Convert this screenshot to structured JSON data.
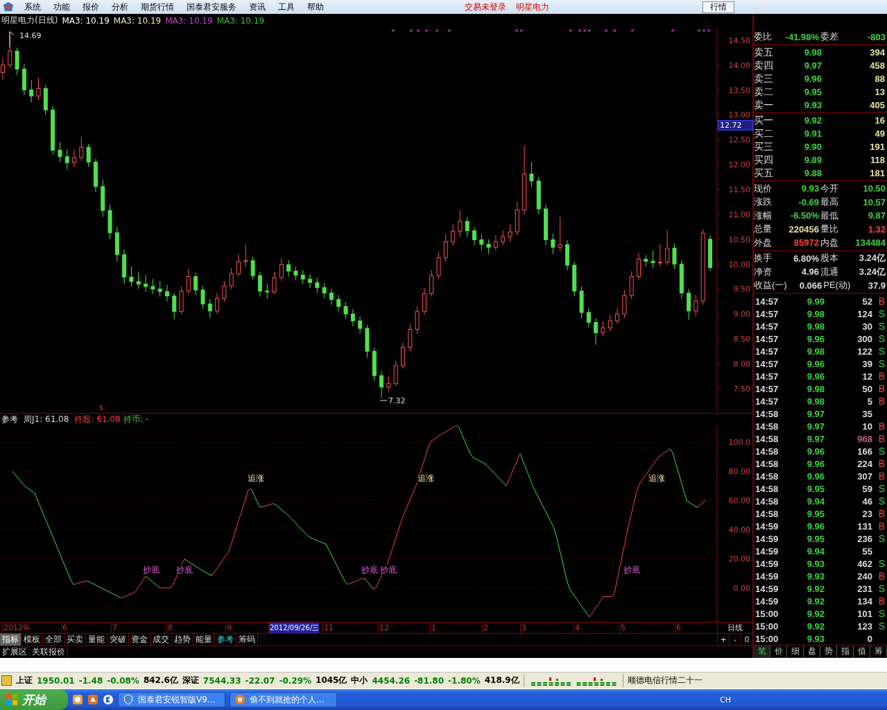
{
  "menu": {
    "items": [
      "系统",
      "功能",
      "报价",
      "分析",
      "期货行情",
      "国泰君安服务",
      "资讯",
      "工具",
      "帮助"
    ],
    "status_texts": [
      "交易未登录",
      "明星电力"
    ],
    "button": "行情"
  },
  "price_chart": {
    "title": "明星电力(日线)",
    "ma": [
      {
        "label": "MA3: 10.19",
        "color": "#ffffff"
      },
      {
        "label": "MA3: 10.19",
        "color": "#f0e8b0"
      },
      {
        "label": "MA3: 10.19",
        "color": "#d040d0"
      },
      {
        "label": "MA3: 10.19",
        "color": "#40c040"
      }
    ],
    "high_label": "14.69",
    "low_label": "7.32",
    "marker": "S",
    "price_tag": "12.72",
    "chart_data": {
      "type": "candlestick",
      "ylim": [
        7.01,
        14.75
      ],
      "yticks": [
        {
          "value": 14.5,
          "label": "14.50"
        },
        {
          "value": 14,
          "label": "14.00"
        },
        {
          "value": 13.5,
          "label": "13.50"
        },
        {
          "value": 13,
          "label": "13.00"
        },
        {
          "value": 12.5,
          "label": "12.50"
        },
        {
          "value": 12,
          "label": "12.00"
        },
        {
          "value": 11.5,
          "label": "11.50"
        },
        {
          "value": 11,
          "label": "11.00"
        },
        {
          "value": 10.5,
          "label": "10.50"
        },
        {
          "value": 10,
          "label": "10.00"
        },
        {
          "value": 9.5,
          "label": "9.50"
        },
        {
          "value": 9,
          "label": "9.00"
        },
        {
          "value": 8.5,
          "label": "8.50"
        },
        {
          "value": 8,
          "label": "8.00"
        },
        {
          "value": 7.5,
          "label": "7.50"
        }
      ],
      "ohlc": [
        [
          13.85,
          14.15,
          13.7,
          14.0
        ],
        [
          14.0,
          14.69,
          13.95,
          14.28
        ],
        [
          14.28,
          14.35,
          13.8,
          13.92
        ],
        [
          13.92,
          14.02,
          13.4,
          13.5
        ],
        [
          13.5,
          13.7,
          13.25,
          13.38
        ],
        [
          13.38,
          13.75,
          13.3,
          13.53
        ],
        [
          13.53,
          13.6,
          13.0,
          13.1
        ],
        [
          13.1,
          13.18,
          12.2,
          12.29
        ],
        [
          12.29,
          12.45,
          12.05,
          12.16
        ],
        [
          12.16,
          12.3,
          11.9,
          12.04
        ],
        [
          12.04,
          12.3,
          11.95,
          12.14
        ],
        [
          12.14,
          12.55,
          12.08,
          12.35
        ],
        [
          12.35,
          12.42,
          11.95,
          12.05
        ],
        [
          12.05,
          12.12,
          11.45,
          11.56
        ],
        [
          11.56,
          11.7,
          10.95,
          11.08
        ],
        [
          11.08,
          11.2,
          10.5,
          10.63
        ],
        [
          10.63,
          10.75,
          10.05,
          10.19
        ],
        [
          10.19,
          10.3,
          9.6,
          9.74
        ],
        [
          9.74,
          9.95,
          9.55,
          9.65
        ],
        [
          9.65,
          9.85,
          9.5,
          9.6
        ],
        [
          9.6,
          9.78,
          9.44,
          9.55
        ],
        [
          9.55,
          9.7,
          9.4,
          9.5
        ],
        [
          9.5,
          9.66,
          9.35,
          9.45
        ],
        [
          9.45,
          9.58,
          9.25,
          9.36
        ],
        [
          9.36,
          9.42,
          8.9,
          9.05
        ],
        [
          9.05,
          9.55,
          9.0,
          9.46
        ],
        [
          9.46,
          9.9,
          9.4,
          9.75
        ],
        [
          9.75,
          9.82,
          9.38,
          9.48
        ],
        [
          9.48,
          9.56,
          9.1,
          9.2
        ],
        [
          9.2,
          9.3,
          8.92,
          9.06
        ],
        [
          9.06,
          9.42,
          9.0,
          9.31
        ],
        [
          9.31,
          9.66,
          9.25,
          9.56
        ],
        [
          9.56,
          9.92,
          9.5,
          9.81
        ],
        [
          9.81,
          10.2,
          9.75,
          10.05
        ],
        [
          10.05,
          10.4,
          9.95,
          10.07
        ],
        [
          10.07,
          10.15,
          9.68,
          9.77
        ],
        [
          9.77,
          9.85,
          9.35,
          9.46
        ],
        [
          9.46,
          9.6,
          9.3,
          9.44
        ],
        [
          9.44,
          9.85,
          9.4,
          9.73
        ],
        [
          9.73,
          10.12,
          9.66,
          9.99
        ],
        [
          9.99,
          10.08,
          9.75,
          9.86
        ],
        [
          9.86,
          9.95,
          9.68,
          9.78
        ],
        [
          9.78,
          9.88,
          9.6,
          9.7
        ],
        [
          9.7,
          9.8,
          9.52,
          9.63
        ],
        [
          9.63,
          9.72,
          9.42,
          9.53
        ],
        [
          9.53,
          9.62,
          9.32,
          9.42
        ],
        [
          9.42,
          9.5,
          9.18,
          9.29
        ],
        [
          9.29,
          9.38,
          9.05,
          9.15
        ],
        [
          9.15,
          9.24,
          8.9,
          9.0
        ],
        [
          9.0,
          9.1,
          8.75,
          8.86
        ],
        [
          8.86,
          8.95,
          8.6,
          8.71
        ],
        [
          8.71,
          8.78,
          8.12,
          8.25
        ],
        [
          8.25,
          8.32,
          7.65,
          7.76
        ],
        [
          7.76,
          7.85,
          7.32,
          7.53
        ],
        [
          7.53,
          7.75,
          7.45,
          7.6
        ],
        [
          7.6,
          8.05,
          7.55,
          7.96
        ],
        [
          7.96,
          8.42,
          7.9,
          8.33
        ],
        [
          8.33,
          8.8,
          8.25,
          8.69
        ],
        [
          8.69,
          9.15,
          8.6,
          9.05
        ],
        [
          9.05,
          9.52,
          8.98,
          9.41
        ],
        [
          9.41,
          9.88,
          9.35,
          9.77
        ],
        [
          9.77,
          10.25,
          9.7,
          10.13
        ],
        [
          10.13,
          10.6,
          10.05,
          10.45
        ],
        [
          10.45,
          10.8,
          10.38,
          10.66
        ],
        [
          10.66,
          11.08,
          10.55,
          10.86
        ],
        [
          10.86,
          10.95,
          10.55,
          10.67
        ],
        [
          10.67,
          10.75,
          10.38,
          10.49
        ],
        [
          10.49,
          10.6,
          10.28,
          10.4
        ],
        [
          10.4,
          10.5,
          10.2,
          10.34
        ],
        [
          10.34,
          10.58,
          10.28,
          10.45
        ],
        [
          10.45,
          10.68,
          10.38,
          10.55
        ],
        [
          10.55,
          10.8,
          10.45,
          10.65
        ],
        [
          10.65,
          11.25,
          10.58,
          11.09
        ],
        [
          11.09,
          12.38,
          11.0,
          11.81
        ],
        [
          11.81,
          12.05,
          11.55,
          11.67
        ],
        [
          11.67,
          11.75,
          11.0,
          11.11
        ],
        [
          11.11,
          11.2,
          10.38,
          10.49
        ],
        [
          10.49,
          10.62,
          10.2,
          10.34
        ],
        [
          10.34,
          10.95,
          10.25,
          10.39
        ],
        [
          10.39,
          10.48,
          9.88,
          9.98
        ],
        [
          9.98,
          10.05,
          9.35,
          9.46
        ],
        [
          9.46,
          9.55,
          8.92,
          9.03
        ],
        [
          9.03,
          9.12,
          8.72,
          8.83
        ],
        [
          8.83,
          8.92,
          8.38,
          8.62
        ],
        [
          8.62,
          8.85,
          8.55,
          8.72
        ],
        [
          8.72,
          8.98,
          8.65,
          8.86
        ],
        [
          8.86,
          9.12,
          8.8,
          9.0
        ],
        [
          9.0,
          9.48,
          8.92,
          9.37
        ],
        [
          9.37,
          9.86,
          9.3,
          9.75
        ],
        [
          9.75,
          10.22,
          9.68,
          10.1
        ],
        [
          10.1,
          10.18,
          9.95,
          10.06
        ],
        [
          10.06,
          10.28,
          9.92,
          10.03
        ],
        [
          10.03,
          10.4,
          9.95,
          10.04
        ],
        [
          10.04,
          10.68,
          9.98,
          10.32
        ],
        [
          10.32,
          10.42,
          9.9,
          10.0
        ],
        [
          10.0,
          10.08,
          9.3,
          9.42
        ],
        [
          9.42,
          9.5,
          8.88,
          9.06
        ],
        [
          9.06,
          9.38,
          8.95,
          9.26
        ],
        [
          9.26,
          10.7,
          9.18,
          10.62
        ],
        [
          10.5,
          10.57,
          9.87,
          9.93
        ]
      ]
    }
  },
  "indicator": {
    "name": "参考",
    "reading": "周J1: 61.08",
    "hold_stock": "持股: 61.08",
    "hold_cash": "持币: -",
    "labels": [
      {
        "text": "追涨",
        "kind": "chase"
      },
      {
        "text": "追涨",
        "kind": "chase"
      },
      {
        "text": "追涨",
        "kind": "chase"
      },
      {
        "text": "抄底",
        "kind": "bottom"
      },
      {
        "text": "抄底",
        "kind": "bottom"
      },
      {
        "text": "抄底",
        "kind": "bottom"
      },
      {
        "text": "抄底",
        "kind": "bottom"
      },
      {
        "text": "抄底",
        "kind": "bottom"
      }
    ],
    "yticks": [
      "100.0",
      "80.00",
      "60.00",
      "40.00",
      "20.00",
      "0.00"
    ]
  },
  "date_axis": {
    "labels": [
      {
        "text": "2012年",
        "selected": false
      },
      {
        "text": "6",
        "selected": false
      },
      {
        "text": "7",
        "selected": false
      },
      {
        "text": "8",
        "selected": false
      },
      {
        "text": "9",
        "selected": false
      },
      {
        "text": "2012/09/26/三",
        "selected": true
      },
      {
        "text": "11",
        "selected": false
      },
      {
        "text": "12",
        "selected": false
      },
      {
        "text": "1",
        "selected": false
      },
      {
        "text": "2",
        "selected": false
      },
      {
        "text": "3",
        "selected": false
      },
      {
        "text": "4",
        "selected": false
      },
      {
        "text": "5",
        "selected": false
      },
      {
        "text": "6",
        "selected": false
      }
    ],
    "period": "日线",
    "zoom_buttons": [
      "+",
      "-",
      "0"
    ]
  },
  "indicator_tabs": {
    "group": {
      "label": "指标",
      "pressed": true
    },
    "tabs": [
      {
        "label": "模板",
        "selected": false
      },
      {
        "label": "全部",
        "selected": false
      },
      {
        "label": "买卖",
        "selected": false
      },
      {
        "label": "量能",
        "selected": false
      },
      {
        "label": "突破",
        "selected": false
      },
      {
        "label": "资金",
        "selected": false
      },
      {
        "label": "成交",
        "selected": false
      },
      {
        "label": "趋势",
        "selected": false
      },
      {
        "label": "能量",
        "selected": false
      },
      {
        "label": "参考",
        "selected": true
      },
      {
        "label": "筹码",
        "selected": false
      }
    ]
  },
  "area_tabs": [
    "扩展区",
    "关联报价"
  ],
  "quote_panel": {
    "order_ratio": [
      {
        "label": "委比",
        "value": "-41.98%",
        "color": "#40d040"
      },
      {
        "label": "委差",
        "value": "-803",
        "color": "#40d040"
      }
    ],
    "asks": [
      {
        "label": "卖五",
        "price": "9.98",
        "volume": "394"
      },
      {
        "label": "卖四",
        "price": "9.97",
        "volume": "458"
      },
      {
        "label": "卖三",
        "price": "9.96",
        "volume": "88"
      },
      {
        "label": "卖二",
        "price": "9.95",
        "volume": "13"
      },
      {
        "label": "卖一",
        "price": "9.93",
        "volume": "405"
      }
    ],
    "bids": [
      {
        "label": "买一",
        "price": "9.92",
        "volume": "16"
      },
      {
        "label": "买二",
        "price": "9.91",
        "volume": "49"
      },
      {
        "label": "买三",
        "price": "9.90",
        "volume": "191"
      },
      {
        "label": "买四",
        "price": "9.89",
        "volume": "118"
      },
      {
        "label": "买五",
        "price": "9.88",
        "volume": "181"
      }
    ],
    "stats": [
      [
        {
          "label": "现价",
          "value": "9.93",
          "color": "#40d040"
        },
        {
          "label": "今开",
          "value": "10.50",
          "color": "#40d040"
        }
      ],
      [
        {
          "label": "涨跌",
          "value": "-0.69",
          "color": "#40d040"
        },
        {
          "label": "最高",
          "value": "10.57",
          "color": "#40d040"
        }
      ],
      [
        {
          "label": "涨幅",
          "value": "-6.50%",
          "color": "#40d040"
        },
        {
          "label": "最低",
          "value": "9.87",
          "color": "#40d040"
        }
      ],
      [
        {
          "label": "总量",
          "value": "220456",
          "color": "#e8e0a0"
        },
        {
          "label": "量比",
          "value": "1.32",
          "color": "#ff4040"
        }
      ],
      [
        {
          "label": "外盘",
          "value": "85972",
          "color": "#ff4040"
        },
        {
          "label": "内盘",
          "value": "134484",
          "color": "#40d040"
        }
      ]
    ],
    "info": [
      [
        {
          "label": "换手",
          "value": "6.80%"
        },
        {
          "label": "股本",
          "value": "3.24亿"
        }
      ],
      [
        {
          "label": "净资",
          "value": "4.96"
        },
        {
          "label": "流通",
          "value": "3.24亿"
        }
      ],
      [
        {
          "label": "收益(一)",
          "value": "0.066"
        },
        {
          "label": "PE(动)",
          "value": "37.9"
        }
      ]
    ],
    "trades": [
      {
        "time": "14:57",
        "price": "9.99",
        "volume": "52",
        "side": "B",
        "kind": "buy",
        "large": false
      },
      {
        "time": "14:57",
        "price": "9.98",
        "volume": "124",
        "side": "S",
        "kind": "sell",
        "large": false
      },
      {
        "time": "14:57",
        "price": "9.98",
        "volume": "30",
        "side": "S",
        "kind": "sell",
        "large": false
      },
      {
        "time": "14:57",
        "price": "9.96",
        "volume": "300",
        "side": "S",
        "kind": "sell",
        "large": false
      },
      {
        "time": "14:57",
        "price": "9.98",
        "volume": "122",
        "side": "S",
        "kind": "sell",
        "large": false
      },
      {
        "time": "14:57",
        "price": "9.96",
        "volume": "39",
        "side": "S",
        "kind": "sell",
        "large": false
      },
      {
        "time": "14:57",
        "price": "9.96",
        "volume": "12",
        "side": "B",
        "kind": "buy",
        "large": false
      },
      {
        "time": "14:57",
        "price": "9.98",
        "volume": "50",
        "side": "B",
        "kind": "buy",
        "large": false
      },
      {
        "time": "14:57",
        "price": "9.98",
        "volume": "5",
        "side": "B",
        "kind": "buy",
        "large": false
      },
      {
        "time": "14:58",
        "price": "9.97",
        "volume": "35",
        "kind": "neutral",
        "large": false
      },
      {
        "time": "14:58",
        "price": "9.97",
        "volume": "10",
        "side": "B",
        "kind": "buy",
        "large": false
      },
      {
        "time": "14:58",
        "price": "9.97",
        "volume": "968",
        "side": "B",
        "kind": "buy",
        "large": true
      },
      {
        "time": "14:58",
        "price": "9.96",
        "volume": "166",
        "side": "S",
        "kind": "sell",
        "large": false
      },
      {
        "time": "14:58",
        "price": "9.96",
        "volume": "224",
        "side": "B",
        "kind": "buy",
        "large": false
      },
      {
        "time": "14:58",
        "price": "9.96",
        "volume": "307",
        "side": "B",
        "kind": "buy",
        "large": false
      },
      {
        "time": "14:58",
        "price": "9.95",
        "volume": "59",
        "side": "S",
        "kind": "sell",
        "large": false
      },
      {
        "time": "14:58",
        "price": "9.94",
        "volume": "46",
        "side": "S",
        "kind": "sell",
        "large": false
      },
      {
        "time": "14:58",
        "price": "9.95",
        "volume": "23",
        "side": "B",
        "kind": "buy",
        "large": false
      },
      {
        "time": "14:59",
        "price": "9.96",
        "volume": "131",
        "side": "B",
        "kind": "buy",
        "large": false
      },
      {
        "time": "14:59",
        "price": "9.95",
        "volume": "236",
        "side": "S",
        "kind": "sell",
        "large": false
      },
      {
        "time": "14:59",
        "price": "9.94",
        "volume": "55",
        "kind": "neutral",
        "large": false
      },
      {
        "time": "14:59",
        "price": "9.93",
        "volume": "462",
        "side": "S",
        "kind": "sell",
        "large": false
      },
      {
        "time": "14:59",
        "price": "9.93",
        "volume": "240",
        "side": "B",
        "kind": "buy",
        "large": false
      },
      {
        "time": "14:59",
        "price": "9.92",
        "volume": "231",
        "side": "S",
        "kind": "sell",
        "large": false
      },
      {
        "time": "14:59",
        "price": "9.92",
        "volume": "134",
        "side": "B",
        "kind": "buy",
        "large": false
      },
      {
        "time": "15:00",
        "price": "9.92",
        "volume": "101",
        "side": "S",
        "kind": "sell",
        "large": false
      },
      {
        "time": "15:00",
        "price": "9.92",
        "volume": "123",
        "side": "S",
        "kind": "sell",
        "large": false
      },
      {
        "time": "15:00",
        "price": "9.93",
        "volume": "0",
        "kind": "neutral",
        "large": false
      }
    ],
    "tabs": [
      {
        "label": "笔",
        "selected": true
      },
      {
        "label": "价",
        "selected": false
      },
      {
        "label": "细",
        "selected": false
      },
      {
        "label": "盘",
        "selected": false
      },
      {
        "label": "势",
        "selected": false
      },
      {
        "label": "指",
        "selected": false
      },
      {
        "label": "值",
        "selected": false
      },
      {
        "label": "筹",
        "selected": false
      }
    ]
  },
  "status_bar": {
    "segments": [
      {
        "text": "上证",
        "color": "#000000"
      },
      {
        "text": "1950.01",
        "color": "#008000"
      },
      {
        "text": "-1.48",
        "color": "#008000"
      },
      {
        "text": "-0.08%",
        "color": "#008000"
      },
      {
        "text": "842.6亿",
        "color": "#000000"
      },
      {
        "text": "深证",
        "color": "#000000"
      },
      {
        "text": "7544.33",
        "color": "#008000"
      },
      {
        "text": "-22.07",
        "color": "#008000"
      },
      {
        "text": "-0.29%",
        "color": "#008000"
      },
      {
        "text": "1045亿",
        "color": "#000000"
      },
      {
        "text": "中小",
        "color": "#000000"
      },
      {
        "text": "4454.26",
        "color": "#008000"
      },
      {
        "text": "-81.80",
        "color": "#008000"
      },
      {
        "text": "-1.80%",
        "color": "#008000"
      },
      {
        "text": "418.9亿",
        "color": "#000000"
      }
    ],
    "ticker": "顺德电信行情二十一"
  },
  "taskbar": {
    "start": "开始",
    "tasks": [
      "国泰君安锐智版V9...",
      "偷不到就抢的个人..."
    ],
    "tray": "CH"
  }
}
